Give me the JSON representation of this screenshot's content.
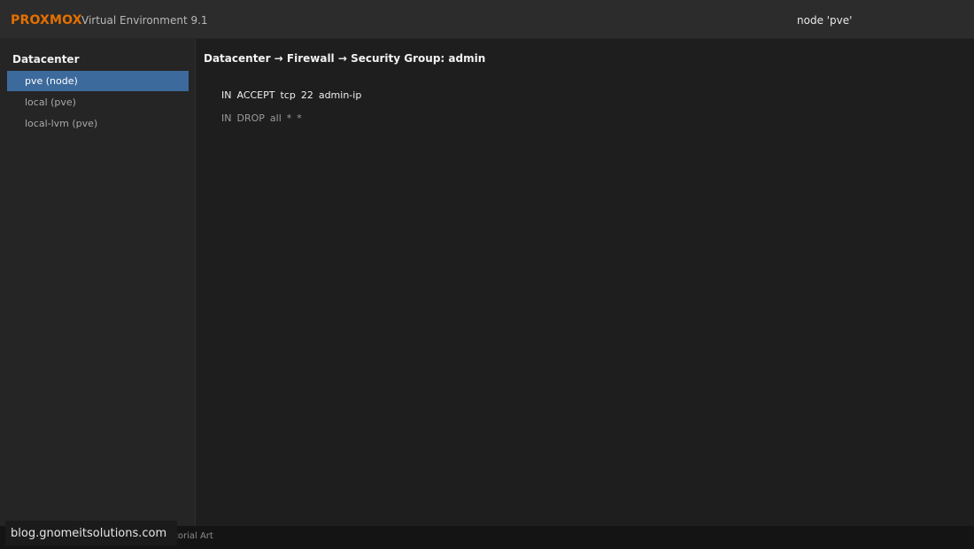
{
  "header": {
    "logo": "PROXMOX",
    "product": "Virtual Environment 9.1",
    "node": "node 'pve'"
  },
  "sidebar": {
    "root": "Datacenter",
    "items": [
      {
        "label": "pve (node)",
        "selected": true
      },
      {
        "label": "local (pve)",
        "selected": false
      },
      {
        "label": "local-lvm (pve)",
        "selected": false
      }
    ]
  },
  "main": {
    "breadcrumb": "Datacenter → Firewall → Security Group: admin",
    "rules": [
      {
        "direction": "IN",
        "action": "ACCEPT",
        "protocol": "tcp",
        "port": "22",
        "source": "admin-ip"
      },
      {
        "direction": "IN",
        "action": "DROP",
        "protocol": "all",
        "port": "*",
        "source": "*"
      }
    ]
  },
  "footer": {
    "credit": "Tutorial Art"
  },
  "watermark": {
    "text": "blog.gnomeitsolutions.com"
  },
  "colors": {
    "brand": "#e57000",
    "selected": "#3d6a9c",
    "background": "#1e1e1e"
  }
}
